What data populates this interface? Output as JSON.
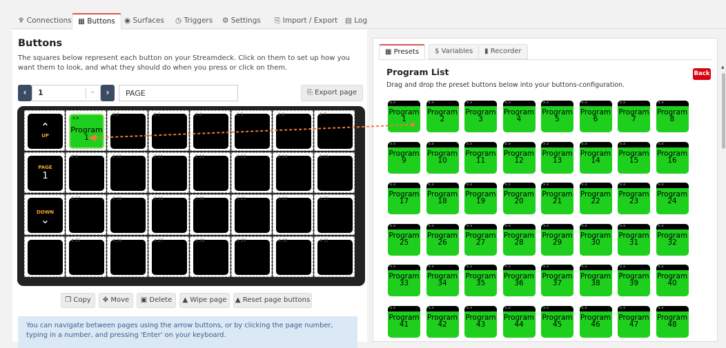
{
  "nav": {
    "tabs": [
      {
        "label": "Connections",
        "icon": "plug-icon"
      },
      {
        "label": "Buttons",
        "icon": "calendar-grid-icon"
      },
      {
        "label": "Surfaces",
        "icon": "gamepad-icon"
      },
      {
        "label": "Triggers",
        "icon": "clock-icon"
      },
      {
        "label": "Settings",
        "icon": "gear-icon"
      },
      {
        "label": "Import / Export",
        "icon": "file-import-icon"
      },
      {
        "label": "Log",
        "icon": "clipboard-icon"
      }
    ],
    "active": "Buttons"
  },
  "buttons": {
    "title": "Buttons",
    "description": "The squares below represent each button on your Streamdeck. Click on them to set up how you want them to look, and what they should do when you press or click on them.",
    "page_number": "1",
    "page_name": "PAGE",
    "export_label": "Export page",
    "nav_up": "UP",
    "nav_page": "PAGE",
    "nav_page_value": "1",
    "nav_down": "DOWN",
    "selected_button": {
      "header": "x.x",
      "label": "Program 1"
    },
    "cell_numbers": [
      "",
      "1.1",
      "1.2",
      "1.3",
      "1.4",
      "1.5",
      "1.6",
      "1.7",
      "",
      "2.9",
      "2.10",
      "2.11",
      "2.12",
      "2.13",
      "2.14",
      "2.15",
      "",
      "3.17",
      "3.18",
      "3.19",
      "3.20",
      "3.21",
      "3.22",
      "3.23",
      "",
      "4.25",
      "4.26",
      "4.27",
      "4.28",
      "4.29",
      "4.30",
      "4.31"
    ],
    "actions": [
      "Copy",
      "Move",
      "Delete",
      "Wipe page",
      "Reset page buttons"
    ],
    "info": "You can navigate between pages using the arrow buttons, or by clicking the page number, typing in a number, and pressing 'Enter' on your keyboard."
  },
  "presets_panel": {
    "tabs": [
      {
        "label": "Presets",
        "icon": "gift-icon"
      },
      {
        "label": "Variables",
        "icon": "dollar-icon"
      },
      {
        "label": "Recorder",
        "icon": "video-icon"
      }
    ],
    "title": "Program List",
    "description": "Drag and drop the preset buttons below into your buttons-configuration.",
    "back_label": "Back",
    "preset_header": "x.x",
    "presets": [
      "Program 1",
      "Program 2",
      "Program 3",
      "Program 4",
      "Program 5",
      "Program 6",
      "Program 7",
      "Program 8",
      "Program 9",
      "Program 10",
      "Program 11",
      "Program 12",
      "Program 13",
      "Program 14",
      "Program 15",
      "Program 16",
      "Program 17",
      "Program 18",
      "Program 19",
      "Program 20",
      "Program 21",
      "Program 22",
      "Program 23",
      "Program 24",
      "Program 25",
      "Program 26",
      "Program 27",
      "Program 28",
      "Program 29",
      "Program 30",
      "Program 31",
      "Program 32",
      "Program 33",
      "Program 34",
      "Program 35",
      "Program 36",
      "Program 37",
      "Program 38",
      "Program 39",
      "Program 40",
      "Program 41",
      "Program 42",
      "Program 43",
      "Program 44",
      "Program 45",
      "Program 46",
      "Program 47",
      "Program 48"
    ]
  },
  "colors": {
    "accent": "#d9534f",
    "preset_green": "#1ecf1e",
    "drag_arrow": "#f07a3a",
    "nav_yellow": "#f5a623"
  }
}
